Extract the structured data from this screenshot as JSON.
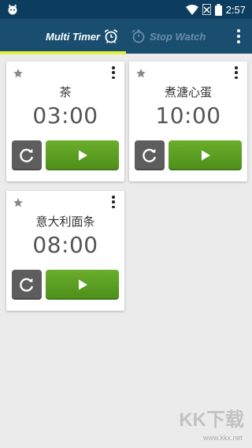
{
  "status_bar": {
    "time": "2:57"
  },
  "tabs": [
    {
      "label": "Multi Timer",
      "icon": "alarm-clock-icon",
      "active": true
    },
    {
      "label": "Stop Watch",
      "icon": "stopwatch-icon",
      "active": false
    }
  ],
  "colors": {
    "app_bar": "#1a4e6f",
    "status_bar": "#0d3d5e",
    "indicator": "#e4ef3c",
    "play": "#5a9f22",
    "reset": "#5d5d5d"
  },
  "timers": [
    {
      "name": "茶",
      "time": "03:00"
    },
    {
      "name": "煮溏心蛋",
      "time": "10:00"
    },
    {
      "name": "意大利面条",
      "time": "08:00"
    }
  ],
  "watermark": {
    "logo": "KK下载",
    "url": "www.kkx.net"
  }
}
